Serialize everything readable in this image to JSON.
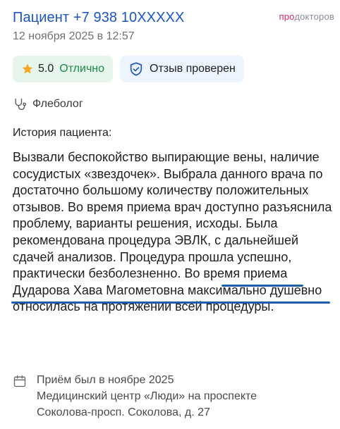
{
  "header": {
    "patient_name": "Пациент +7 938 10XXXXX",
    "date": "12 ноября 2025 в 12:57",
    "logo_prefix": "про",
    "logo_suffix": "докторов"
  },
  "badges": {
    "rating_score": "5.0",
    "rating_grade": "Отлично",
    "verified_label": "Отзыв проверен"
  },
  "specialty": "Флеболог",
  "history_title": "История пациента:",
  "review": {
    "text": "Вызвали беспокойство выпирающие вены, наличие сосудистых «звездочек». Выбрала данного врача по достаточно большому количеству положительных отзывов. Во время приема врач доступно разъяснила проблему, варианты решения, исходы. Была рекомендована процедура ЭВЛК, с дальнейшей сдачей анализов. Процедура прошла успешно, практически безболезненно. Во время приема Дударова Хава Магометовна максимально душевно относилась на протяжении всей процедуры."
  },
  "visit": {
    "when": "Приём был в ноябре 2025",
    "clinic": "Медицинский центр «Люди» на проспекте",
    "address": "Соколова-просп. Соколова, д. 27"
  },
  "colors": {
    "accent_blue": "#1a55c4",
    "rating_bg": "#e6f6ec",
    "verified_bg": "#eef4fd",
    "highlight_underline": "#1c5ea8"
  },
  "icons": {
    "rating": "star-icon",
    "verified": "shield-check-icon",
    "specialty": "stethoscope-icon",
    "visit": "calendar-icon"
  }
}
